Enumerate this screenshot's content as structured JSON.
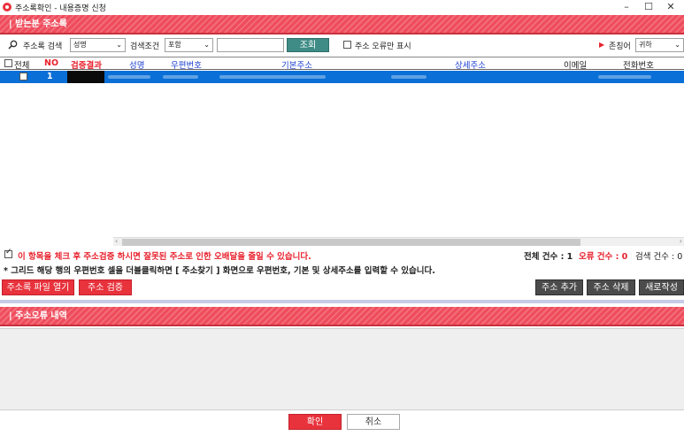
{
  "window": {
    "title": "주소록확인 - 내용증명 신청",
    "minimize": "–",
    "maximize": "☐",
    "close": "✕"
  },
  "sections": {
    "recipients_header": "| 받는분 주소록",
    "error_header": "| 주소오류 내역"
  },
  "search": {
    "label": "주소록 검색",
    "field_value": "성명",
    "condition_label": "검색조건",
    "condition_value": "포함",
    "query_value": "",
    "search_button": "조회",
    "error_only_label": "주소 오류만 표시",
    "honorific_label": "존칭어",
    "honorific_value": "귀하"
  },
  "grid": {
    "headers": {
      "all": "전체",
      "no": "NO",
      "result": "검증결과",
      "name": "성명",
      "zip": "우편번호",
      "base_address": "기본주소",
      "detail_address": "상세주소",
      "email": "이메일",
      "phone": "전화번호"
    },
    "rows": [
      {
        "no": "1"
      }
    ]
  },
  "notices": {
    "checkbox_warning": "이 항목을 체크 후 주소검증 하시면 잘못된 주소로 인한 오배달을 줄일 수 있습니다.",
    "total_label": "전체 건수 : 1",
    "error_label": "오류 건수 : 0",
    "search_count_label": "검색 건수 : 0",
    "hint": "* 그리드 해당 행의 우편번호 셀을 더블클릭하면 [ 주소찾기 ] 화면으로 우편번호, 기본 및 상세주소를 입력할 수 있습니다."
  },
  "actions": {
    "open_file": "주소록 파일 열기",
    "verify": "주소 검증",
    "add": "주소 추가",
    "delete": "주소 삭제",
    "new": "새로작성"
  },
  "footer": {
    "confirm": "확인",
    "cancel": "취소"
  },
  "colors": {
    "accent_red": "#e8323c",
    "teal": "#3f8c86",
    "selection_blue": "#0a6fd6"
  }
}
